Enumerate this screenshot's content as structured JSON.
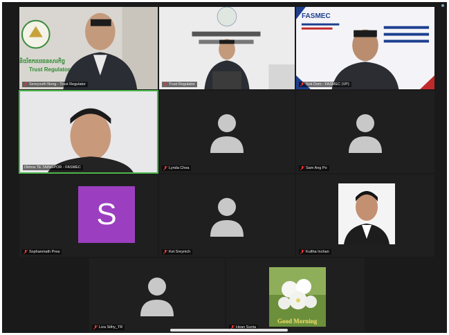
{
  "participants": [
    {
      "name": "Sereyvuth Nong - Trust Regulator"
    },
    {
      "name": "Trust Regulator"
    },
    {
      "name": "Sok Dom - FASMEC (VP)"
    },
    {
      "name": "Okhna TE TAINGPOR - FASMEC"
    },
    {
      "name": "Lynda Chea"
    },
    {
      "name": "Sam Ang Po"
    },
    {
      "name": "Sophanmath Prea"
    },
    {
      "name": "Ket Sreynich"
    },
    {
      "name": "Kultha Inchan"
    },
    {
      "name": "Liza Sithy_TR"
    },
    {
      "name": "Hean Sunta"
    }
  ],
  "sophanmath_initial": "S",
  "trust_logo": {
    "khmer": "និយ័តករបរធនសារកិច្ច",
    "english": "Trust Regulator"
  },
  "fasmec_banner": {
    "brand": "FASMEC"
  },
  "good_morning": "Good Morning",
  "colors": {
    "active_border": "#4cb84c",
    "tile_bg": "#1f1f1f",
    "avatar_purple": "#9b3fc0"
  }
}
